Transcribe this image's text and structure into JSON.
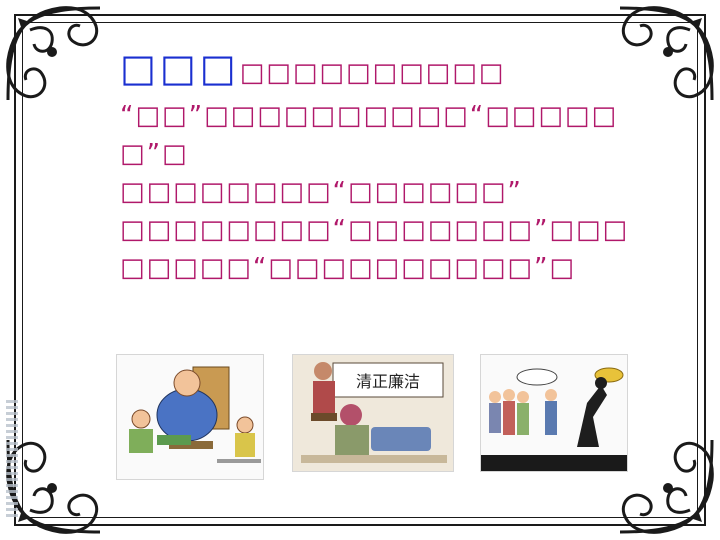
{
  "text": {
    "heading": "□□□",
    "line1_rest": "□□□□□□□□□□",
    "line2": "“□□”□□□□□□□□□□“□□□□□",
    "line3": "□”□",
    "line4": "□□□□□□□□“□□□□□□”",
    "line5": "□□□□□□□□“□□□□□□□”□□□",
    "line6": "□□□□□“□□□□□□□□□□”□"
  },
  "images": [
    {
      "name": "cartoon-bribery"
    },
    {
      "name": "cartoon-clean-governance",
      "scroll_text": "清正廉洁"
    },
    {
      "name": "cartoon-gold-temptation"
    }
  ],
  "colors": {
    "heading": "#1a2fd0",
    "body_text": "#b0186a",
    "frame": "#1a1a1a",
    "background": "#ffffff"
  }
}
